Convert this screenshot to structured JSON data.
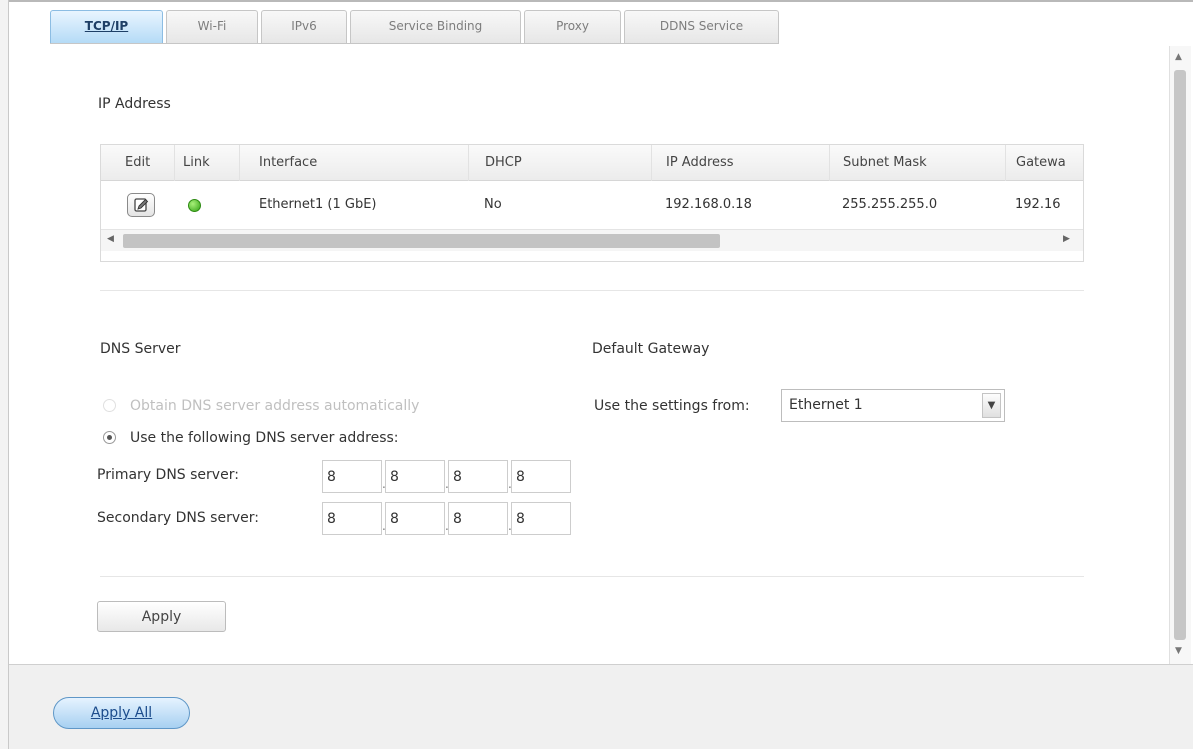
{
  "tabs": [
    {
      "label": "TCP/IP",
      "active": true
    },
    {
      "label": "Wi-Fi",
      "active": false
    },
    {
      "label": "IPv6",
      "active": false
    },
    {
      "label": "Service Binding",
      "active": false
    },
    {
      "label": "Proxy",
      "active": false
    },
    {
      "label": "DDNS Service",
      "active": false
    }
  ],
  "ip_address": {
    "section_title": "IP Address",
    "columns": [
      "Edit",
      "Link",
      "Interface",
      "DHCP",
      "IP Address",
      "Subnet Mask",
      "Gatewa"
    ],
    "rows": [
      {
        "edit_icon": "edit-icon",
        "link_status": "connected",
        "link_color": "#3fae1f",
        "interface": "Ethernet1 (1 GbE)",
        "dhcp": "No",
        "ip_address": "192.168.0.18",
        "subnet_mask": "255.255.255.0",
        "gateway": "192.16"
      }
    ]
  },
  "dns": {
    "section_title": "DNS Server",
    "option_auto": "Obtain DNS server address automatically",
    "option_manual": "Use the following DNS server address:",
    "selected_option": "manual",
    "primary_label": "Primary DNS server:",
    "primary": [
      "8",
      "8",
      "8",
      "8"
    ],
    "secondary_label": "Secondary DNS server:",
    "secondary": [
      "8",
      "8",
      "8",
      "8"
    ]
  },
  "gateway": {
    "section_title": "Default Gateway",
    "use_settings_label": "Use the settings from:",
    "selected": "Ethernet 1"
  },
  "buttons": {
    "apply": "Apply",
    "apply_all": "Apply All"
  },
  "colors": {
    "active_tab": "#b3daf6",
    "accent": "#8cbde3"
  }
}
